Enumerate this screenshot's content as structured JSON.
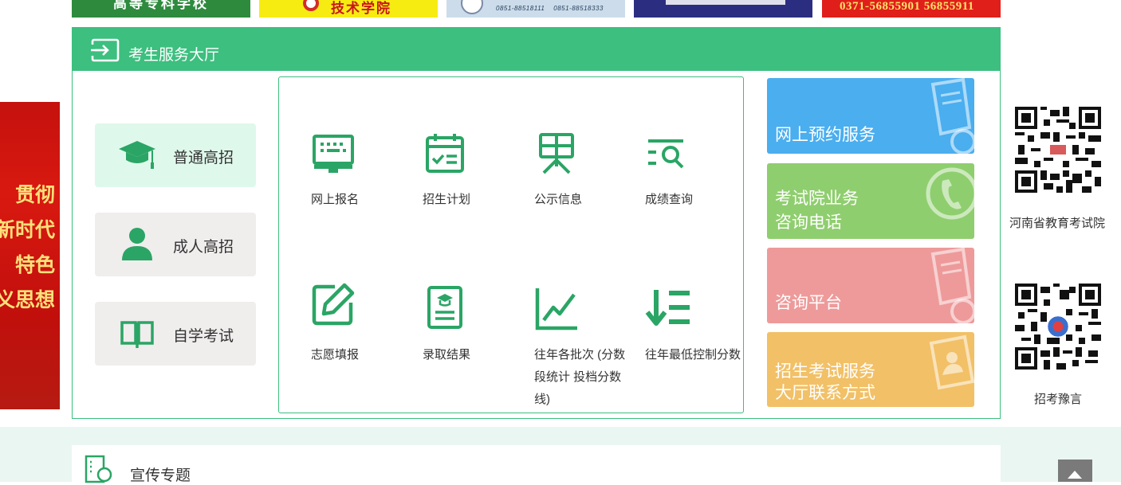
{
  "ads": {
    "ad1": "高等专科学校",
    "ad2": "技术学院",
    "ad3_phones": "0851-88518111    0851-88518333",
    "ad5": "0371-56855901  56855911"
  },
  "left_banner": {
    "lines": [
      "贯彻",
      "新时代",
      "特色",
      "义思想"
    ]
  },
  "hall": {
    "title": "考生服务大厅",
    "categories": [
      {
        "label": "普通高招",
        "icon": "graduation-cap-icon"
      },
      {
        "label": "成人高招",
        "icon": "person-icon"
      },
      {
        "label": "自学考试",
        "icon": "open-book-icon"
      }
    ],
    "services": [
      {
        "label": "网上报名",
        "icon": "monitor-keyboard-icon"
      },
      {
        "label": "招生计划",
        "icon": "calendar-check-icon"
      },
      {
        "label": "公示信息",
        "icon": "notice-board-icon"
      },
      {
        "label": "成绩查询",
        "icon": "list-search-icon"
      },
      {
        "label": "志愿填报",
        "icon": "edit-pen-icon"
      },
      {
        "label": "录取结果",
        "icon": "document-cap-icon"
      },
      {
        "label": "往年各批次 (分数段统计 投档分数线)",
        "icon": "line-chart-icon"
      },
      {
        "label": "往年最低控制分数",
        "icon": "sort-descending-icon"
      }
    ],
    "side_buttons": [
      {
        "label": "网上预约服务",
        "color": "#4aaeef",
        "icon": "document-search-icon"
      },
      {
        "label": "考试院业务\n咨询电话",
        "line1": "考试院业务",
        "line2": "咨询电话",
        "color": "#8fce6e",
        "icon": "phone-icon"
      },
      {
        "label": "咨询平台",
        "color": "#ee9a9a",
        "icon": "document-search-icon"
      },
      {
        "label": "招生考试服务\n大厅联系方式",
        "line1": "招生考试服务",
        "line2": "大厅联系方式",
        "color": "#f2c066",
        "icon": "contact-card-icon"
      }
    ]
  },
  "qr_codes": [
    {
      "caption": "河南省教育考试院"
    },
    {
      "caption": "招考豫言"
    }
  ],
  "promo": {
    "title": "宣传专题"
  },
  "colors": {
    "accent_green": "#3cbf7f",
    "icon_green": "#2aa565"
  }
}
